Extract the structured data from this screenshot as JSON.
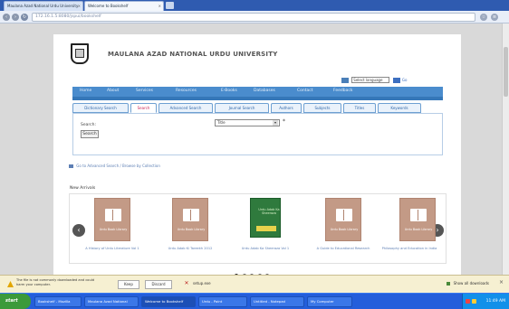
{
  "browser": {
    "tabs": [
      {
        "label": "Maulana Azad National Urdu University",
        "active": false
      },
      {
        "label": "Welcome to Bookshelf",
        "active": true
      }
    ],
    "address": "172.16.1.5:8080/jspui/bookshelf"
  },
  "page": {
    "university_title": "MAULANA AZAD NATIONAL URDU UNIVERSITY",
    "language": {
      "label": "Select language",
      "go_label": "Go"
    },
    "main_nav": [
      "Home",
      "About",
      "Services",
      "Resources",
      "E-Books",
      "Databases",
      "Contact",
      "Feedback"
    ],
    "section_tabs": [
      {
        "label": "Dictionary Search",
        "active": false
      },
      {
        "label": "Search",
        "active": true
      },
      {
        "label": "Advanced Search",
        "active": false
      },
      {
        "label": "Journal Search",
        "active": false
      },
      {
        "label": "Authors",
        "active": false
      },
      {
        "label": "Subjects",
        "active": false
      },
      {
        "label": "Titles",
        "active": false
      },
      {
        "label": "Keywords",
        "active": false
      }
    ],
    "search": {
      "label": "Search:",
      "type_value": "Title",
      "star": "*",
      "button_label": "Search"
    },
    "advanced_link": "Go to Advanced Search / Browse by Collection",
    "new_arrivals_heading": "New Arrivals",
    "books": [
      {
        "cover_text": "Urdu Book Library",
        "caption": "A History of Urdu Literature Vol 1",
        "color": "#c39a86"
      },
      {
        "cover_text": "Urdu Book Library",
        "caption": "Urdu Adab Ki Tareekh 2012",
        "color": "#c39a86"
      },
      {
        "cover_text": "Urdu Adab Ka Sheeraza",
        "caption": "Urdu Adab Ka Sheeraza Vol 1",
        "color": "#2f7a3d"
      },
      {
        "cover_text": "Urdu Book Library",
        "caption": "A Guide to Educational Research",
        "color": "#c39a86"
      },
      {
        "cover_text": "Urdu Book Library",
        "caption": "Philosophy and Education in India",
        "color": "#c39a86"
      }
    ],
    "carousel_dot_count": 5,
    "active_dot": 1
  },
  "download_bar": {
    "message": "The file is not commonly downloaded and could harm your computer.",
    "keep_label": "Keep",
    "discard_label": "Discard",
    "file_name": "setup.exe",
    "right_label": "Show all downloads"
  },
  "taskbar": {
    "start_label": "start",
    "items": [
      {
        "label": "Bookshelf - Mozilla",
        "active": false
      },
      {
        "label": "Maulana Azad National",
        "active": false
      },
      {
        "label": "Welcome to Bookshelf",
        "active": true
      },
      {
        "label": "Urdu - Paint",
        "active": false
      },
      {
        "label": "Untitled - Notepad",
        "active": false
      },
      {
        "label": "My Computer",
        "active": false
      }
    ],
    "clock": "11:49 AM"
  },
  "colors": {
    "accent": "#4a8ccd",
    "taskbar": "#245edb",
    "start": "#3c9a3a"
  }
}
